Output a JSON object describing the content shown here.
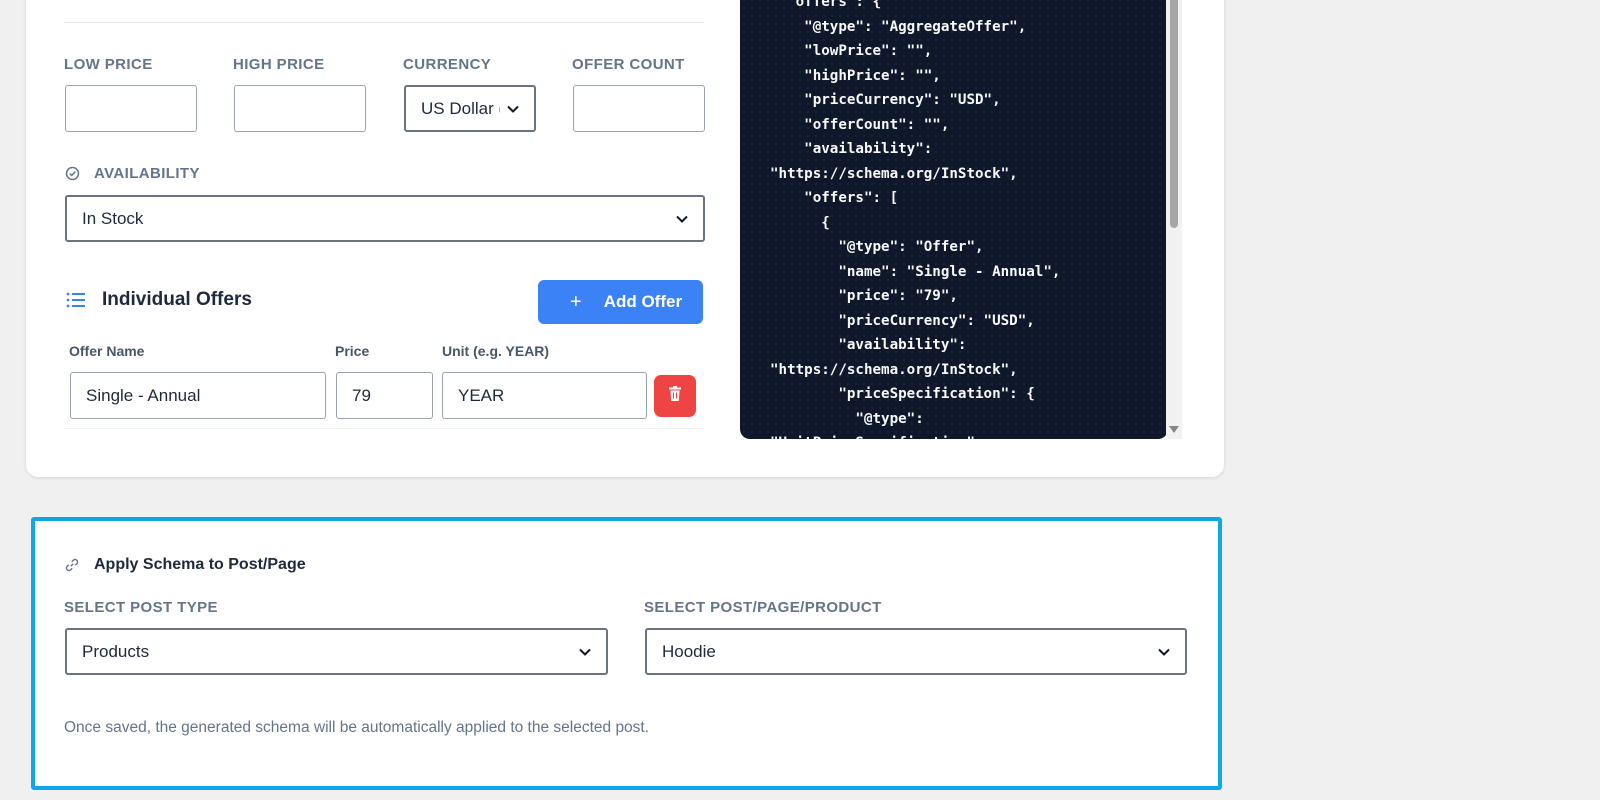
{
  "pricing": {
    "low_price_label": "LOW PRICE",
    "high_price_label": "HIGH PRICE",
    "currency_label": "CURRENCY",
    "offer_count_label": "OFFER COUNT",
    "low_price_value": "",
    "high_price_value": "",
    "currency_value": "US Dollar (USD)",
    "offer_count_value": ""
  },
  "availability": {
    "label": "AVAILABILITY",
    "value": "In Stock"
  },
  "offers": {
    "title": "Individual Offers",
    "add_button": "Add Offer",
    "add_button_icon": "+",
    "col_name": "Offer Name",
    "col_price": "Price",
    "col_unit": "Unit (e.g. YEAR)",
    "rows": [
      {
        "name": "Single - Annual",
        "price": "79",
        "unit": "YEAR"
      }
    ]
  },
  "code_preview": {
    "text": "  \"offers\": {\n    \"@type\": \"AggregateOffer\",\n    \"lowPrice\": \"\",\n    \"highPrice\": \"\",\n    \"priceCurrency\": \"USD\",\n    \"offerCount\": \"\",\n    \"availability\":\n\"https://schema.org/InStock\",\n    \"offers\": [\n      {\n        \"@type\": \"Offer\",\n        \"name\": \"Single - Annual\",\n        \"price\": \"79\",\n        \"priceCurrency\": \"USD\",\n        \"availability\":\n\"https://schema.org/InStock\",\n        \"priceSpecification\": {\n          \"@type\":\n\"UnitPriceSpecification\","
  },
  "apply_schema": {
    "title": "Apply Schema to Post/Page",
    "post_type_label": "SELECT POST TYPE",
    "post_type_value": "Products",
    "post_label": "SELECT POST/PAGE/PRODUCT",
    "post_value": "Hoodie",
    "note": "Once saved, the generated schema will be automatically applied to the selected post."
  },
  "colors": {
    "primary": "#3b82f6",
    "danger": "#ef4444",
    "highlight_border": "#0ea5e9",
    "code_bg": "#0f172a"
  }
}
